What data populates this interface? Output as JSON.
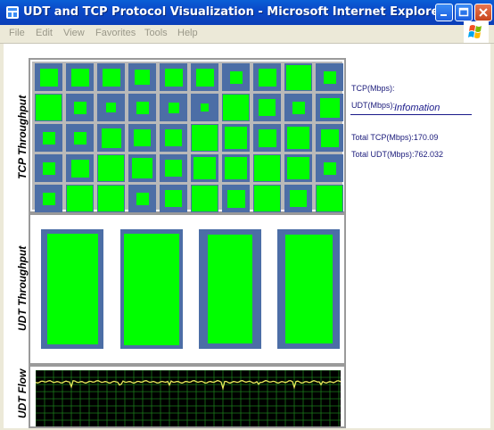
{
  "window": {
    "title": "UDT and TCP Protocol Visualization - Microsoft Internet Explorer"
  },
  "menu": [
    "File",
    "Edit",
    "View",
    "Favorites",
    "Tools",
    "Help"
  ],
  "panels": {
    "tcp_label": "TCP Throughput",
    "udt_label": "UDT Throughput",
    "flow_label": "UDT Flow"
  },
  "info": {
    "title": "Infomation",
    "tcp": "TCP(Mbps):",
    "udt": "UDT(Mbps):",
    "total_tcp": "Total TCP(Mbps):170.09",
    "total_udt": "Total UDT(Mbps):762.032"
  },
  "tcp_grid_fill_fractions": [
    [
      0.65,
      0.65,
      0.65,
      0.55,
      0.65,
      0.65,
      0.45,
      0.65,
      0.9,
      0.45
    ],
    [
      0.95,
      0.45,
      0.35,
      0.45,
      0.4,
      0.3,
      0.95,
      0.6,
      0.45,
      0.7
    ],
    [
      0.45,
      0.45,
      0.7,
      0.6,
      0.6,
      0.95,
      0.8,
      0.65,
      0.8,
      0.65
    ],
    [
      0.45,
      0.65,
      0.95,
      0.75,
      0.6,
      0.8,
      0.8,
      0.95,
      0.8,
      0.45
    ],
    [
      0.45,
      0.95,
      0.95,
      0.45,
      0.6,
      0.95,
      0.65,
      0.95,
      0.6,
      0.95
    ]
  ],
  "udt_bars_fill_fractions": [
    0.82,
    0.88,
    0.72,
    0.75
  ],
  "colors": {
    "fill": "#00ff00",
    "cell": "#4c6ea6",
    "flow_line": "#e8e85a",
    "flow_grid": "#1a7a1a"
  }
}
